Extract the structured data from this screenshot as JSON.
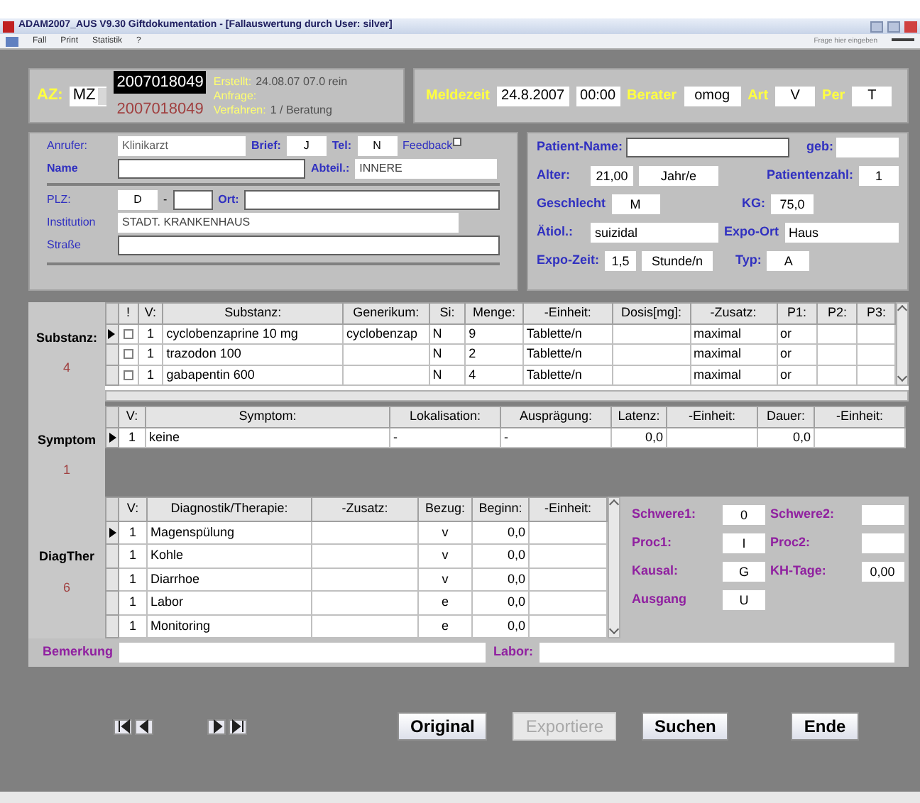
{
  "window": {
    "title": "ADAM2007_AUS V9.30  Giftdokumentation - [Fallauswertung durch User: silver]"
  },
  "menu": [
    "Fall",
    "Print",
    "Statistik",
    "?"
  ],
  "help_search": {
    "placeholder": "Frage hier eingeben"
  },
  "case": {
    "az_label": "AZ:",
    "prefix": "MZ",
    "number": "2007018049",
    "number_selected": true,
    "original_number": "2007018049",
    "info": [
      {
        "label": "Erstellt:",
        "value": "24.08.07 07.0 rein"
      },
      {
        "label": "Anfrage:"
      },
      {
        "label": "Verfahren:",
        "value": "1 / Beratung"
      }
    ]
  },
  "report": [
    {
      "label": "Meldezeit",
      "value": "24.8.2007"
    },
    {
      "value": "00:00"
    },
    {
      "label": "Berater",
      "value": "omog"
    },
    {
      "label": "Art",
      "value": "V"
    },
    {
      "label": "Per",
      "value": "T"
    }
  ],
  "caller": {
    "anrufer": {
      "label": "Anrufer:",
      "value": "Klinikarzt"
    },
    "brief": {
      "label": "Brief:",
      "value": "J"
    },
    "tel": {
      "label": "Tel:",
      "value": "N"
    },
    "feedback": {
      "label": "Feedback",
      "checked": false
    },
    "name": {
      "label": "Name"
    },
    "abteil": {
      "label": "Abteil.:",
      "value": "INNERE"
    },
    "plz": {
      "label": "PLZ:",
      "country": "D",
      "dash": "-"
    },
    "ort": {
      "label": "Ort:"
    },
    "institution": {
      "label": "Institution",
      "value": "STADT. KRANKENHAUS"
    },
    "strasse": {
      "label": "Straße"
    }
  },
  "patient": {
    "name": {
      "label": "Patient-Name:"
    },
    "geb": {
      "label": "geb:"
    },
    "alter": {
      "label": "Alter:",
      "value": "21,00",
      "unit": "Jahr/e"
    },
    "patientenzahl": {
      "label": "Patientenzahl:",
      "value": "1"
    },
    "geschlecht": {
      "label": "Geschlecht",
      "value": "M"
    },
    "kg": {
      "label": "KG:",
      "value": "75,0"
    },
    "aetiol": {
      "label": "Ätiol.:",
      "value": "suizidal"
    },
    "expo_ort": {
      "label": "Expo-Ort",
      "value": "Haus"
    },
    "expo_zeit": {
      "label": "Expo-Zeit:",
      "value": "1,5",
      "unit": "Stunde/n"
    },
    "typ": {
      "label": "Typ:",
      "value": "A"
    }
  },
  "substances": {
    "label": "Substanz:",
    "count": "4",
    "columns": [
      "!",
      "V:",
      "Substanz:",
      "Generikum:",
      "Si:",
      "Menge:",
      "-Einheit:",
      "Dosis[mg]:",
      "-Zusatz:",
      "P1:",
      "P2:",
      "P3:"
    ],
    "rows": [
      {
        "current": true,
        "cells": [
          {
            "kind": "checkbox",
            "checked": false
          },
          "1",
          "cyclobenzaprine 10 mg",
          "cyclobenzap",
          "N",
          "9",
          "Tablette/n",
          "",
          "maximal",
          "or",
          "",
          ""
        ]
      },
      {
        "current": false,
        "cells": [
          {
            "kind": "checkbox",
            "checked": false
          },
          "1",
          "trazodon 100",
          "",
          "N",
          "2",
          "Tablette/n",
          "",
          "maximal",
          "or",
          "",
          ""
        ]
      },
      {
        "current": false,
        "cells": [
          {
            "kind": "checkbox",
            "checked": false
          },
          "1",
          "gabapentin 600",
          "",
          "N",
          "4",
          "Tablette/n",
          "",
          "maximal",
          "or",
          "",
          ""
        ]
      }
    ]
  },
  "symptoms": {
    "label": "Symptom",
    "count": "1",
    "columns": [
      "V:",
      "Symptom:",
      "Lokalisation:",
      "Ausprägung:",
      "Latenz:",
      "-Einheit:",
      "Dauer:",
      "-Einheit:"
    ],
    "rows": [
      {
        "current": true,
        "cells": [
          "1",
          "keine",
          "-",
          "-",
          "0,0",
          "",
          "0,0",
          ""
        ]
      }
    ]
  },
  "diagther": {
    "label": "DiagTher",
    "count": "6",
    "columns": [
      "V:",
      "Diagnostik/Therapie:",
      "-Zusatz:",
      "Bezug:",
      "Beginn:",
      "-Einheit:"
    ],
    "rows": [
      {
        "current": true,
        "cells": [
          "1",
          "Magenspülung",
          "",
          "v",
          "0,0",
          ""
        ]
      },
      {
        "current": false,
        "cells": [
          "1",
          "Kohle",
          "",
          "v",
          "0,0",
          ""
        ]
      },
      {
        "current": false,
        "cells": [
          "1",
          "Diarrhoe",
          "",
          "v",
          "0,0",
          ""
        ]
      },
      {
        "current": false,
        "cells": [
          "1",
          "Labor",
          "",
          "e",
          "0,0",
          ""
        ]
      },
      {
        "current": false,
        "cells": [
          "1",
          "Monitoring",
          "",
          "e",
          "0,0",
          ""
        ]
      }
    ]
  },
  "assessment": [
    {
      "label": "Schwere1:",
      "value": "0"
    },
    {
      "label": "Schwere2:"
    },
    {
      "label": "Proc1:",
      "value": "I"
    },
    {
      "label": "Proc2:"
    },
    {
      "label": "Kausal:",
      "value": "G"
    },
    {
      "label": "KH-Tage:",
      "value": "0,00"
    },
    {
      "label": "Ausgang",
      "value": "U"
    }
  ],
  "remarks": [
    {
      "label": "Bemerkung"
    },
    {
      "label": "Labor:"
    }
  ],
  "navigation": [
    {
      "kind": "first"
    },
    {
      "kind": "prev"
    },
    {
      "kind": "next"
    },
    {
      "kind": "last"
    }
  ],
  "buttons": [
    {
      "label": "Original",
      "disabled": false
    },
    {
      "label": "Exportiere",
      "disabled": true
    },
    {
      "label": "Suchen",
      "disabled": false
    },
    {
      "label": "Ende",
      "disabled": false
    }
  ]
}
